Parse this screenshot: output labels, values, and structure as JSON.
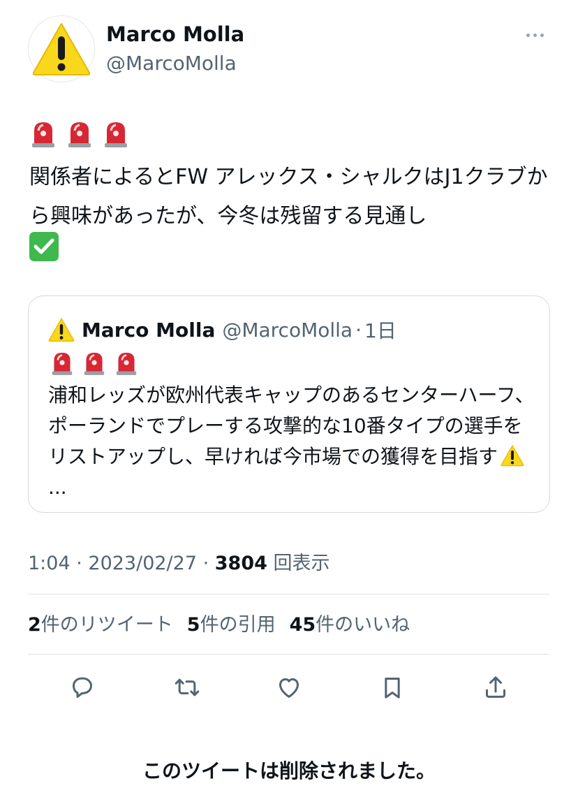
{
  "author": {
    "name": "Marco Molla",
    "handle": "@MarcoMolla",
    "avatar_icon": "warning-icon"
  },
  "tweet": {
    "leading_emoji": [
      "police-light-icon",
      "police-light-icon",
      "police-light-icon"
    ],
    "text": "関係者によるとFW アレックス・シャルクはJ1クラブから興味があったが、今冬は残留する見通し",
    "trailing_emoji": "check-mark-button-icon"
  },
  "quoted_tweet": {
    "author_name": "Marco Molla",
    "author_handle": "@MarcoMolla",
    "separator": "·",
    "time": "1日",
    "leading_emoji": [
      "police-light-icon",
      "police-light-icon",
      "police-light-icon"
    ],
    "text": "浦和レッズが欧州代表キャップのあるセンターハーフ、ポーランドでプレーする攻撃的な10番タイプの選手をリストアップし、早ければ今市場での獲得を目指す",
    "ellipsis": "..."
  },
  "meta": {
    "time": "1:04",
    "sep1": " · ",
    "date": "2023/02/27",
    "sep2": " · ",
    "views_count": "3804",
    "views_label": " 回表示"
  },
  "stats": {
    "retweets_count": "2",
    "retweets_label": "件のリツイート",
    "quotes_count": "5",
    "quotes_label": "件の引用",
    "likes_count": "45",
    "likes_label": "件のいいね"
  },
  "actions": [
    "reply-icon",
    "retweet-icon",
    "like-icon",
    "bookmark-icon",
    "share-icon"
  ],
  "footer": {
    "deleted_notice": "このツイートは削除されました。"
  },
  "colors": {
    "text_primary": "#0f1419",
    "text_secondary": "#536471",
    "divider": "#dfe3e7",
    "warning_yellow": "#f9d71c",
    "check_green": "#3fb94d",
    "siren_red": "#d62834"
  }
}
